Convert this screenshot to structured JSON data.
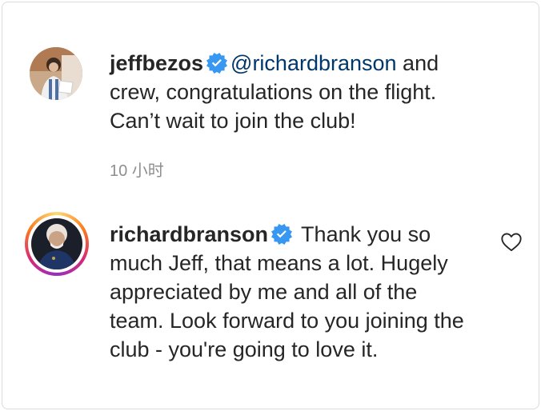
{
  "comments": [
    {
      "username": "jeffbezos",
      "mention": "@richardbranson",
      "text": " and crew, congratulations on the flight. Can’t wait to join the club!",
      "timestamp": "10 小时",
      "verified": true
    },
    {
      "username": "richardbranson",
      "text": " Thank you so much Jeff, that means a lot. Hugely appreciated by me and all of the team. Look forward to you joining the club - you're going to love it.",
      "verified": true,
      "has_story": true
    }
  ],
  "icons": {
    "verified": "verified-badge-icon",
    "like": "heart-outline-icon"
  },
  "colors": {
    "verified_blue": "#3897f0",
    "mention": "#00376b",
    "meta_gray": "#8e8e8e"
  }
}
